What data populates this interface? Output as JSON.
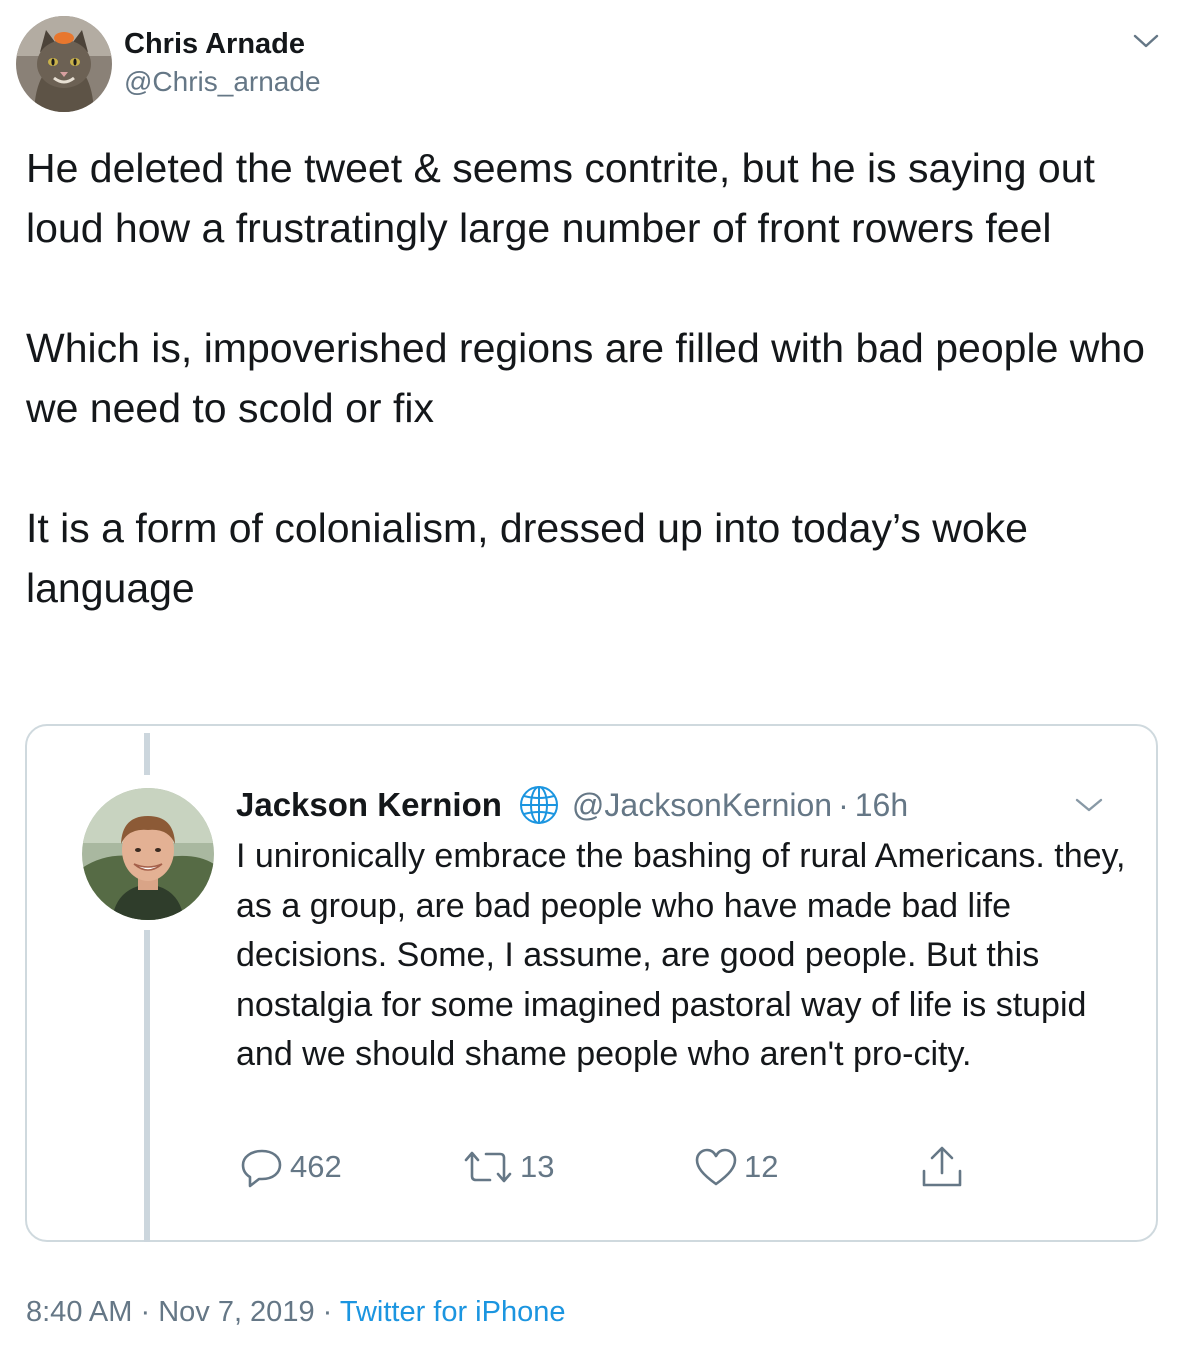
{
  "tweet": {
    "author_name": "Chris Arnade",
    "author_handle": "@Chris_arnade",
    "avatar_icon": "cat-avatar",
    "paragraphs": [
      "He deleted the tweet & seems contrite, but he is saying out loud how a frustratingly large number of front rowers feel",
      "Which is, impoverished regions are filled with bad people who we need to scold or fix",
      "It is a form of colonialism, dressed up into today’s woke language"
    ],
    "time": "8:40 AM",
    "date": "Nov 7, 2019",
    "separator": " · ",
    "source": "Twitter for iPhone"
  },
  "quoted_tweet": {
    "author_name": "Jackson Kernion",
    "author_handle": "@JacksonKernion",
    "dot": "·",
    "time": "16h",
    "avatar_icon": "person-avatar",
    "text": "I unironically embrace the bashing of rural Americans. they, as a group, are bad people who have made bad life decisions. Some, I assume, are good people. But this nostalgia for some imagined pastoral way of life is stupid and we should shame people who aren't pro-city.",
    "replies": "462",
    "retweets": "13",
    "likes": "12"
  },
  "colors": {
    "text": "#14171a",
    "secondary": "#657786",
    "link": "#1b95e0",
    "border": "#cfd9de",
    "thread_line": "#ccd6dd"
  }
}
